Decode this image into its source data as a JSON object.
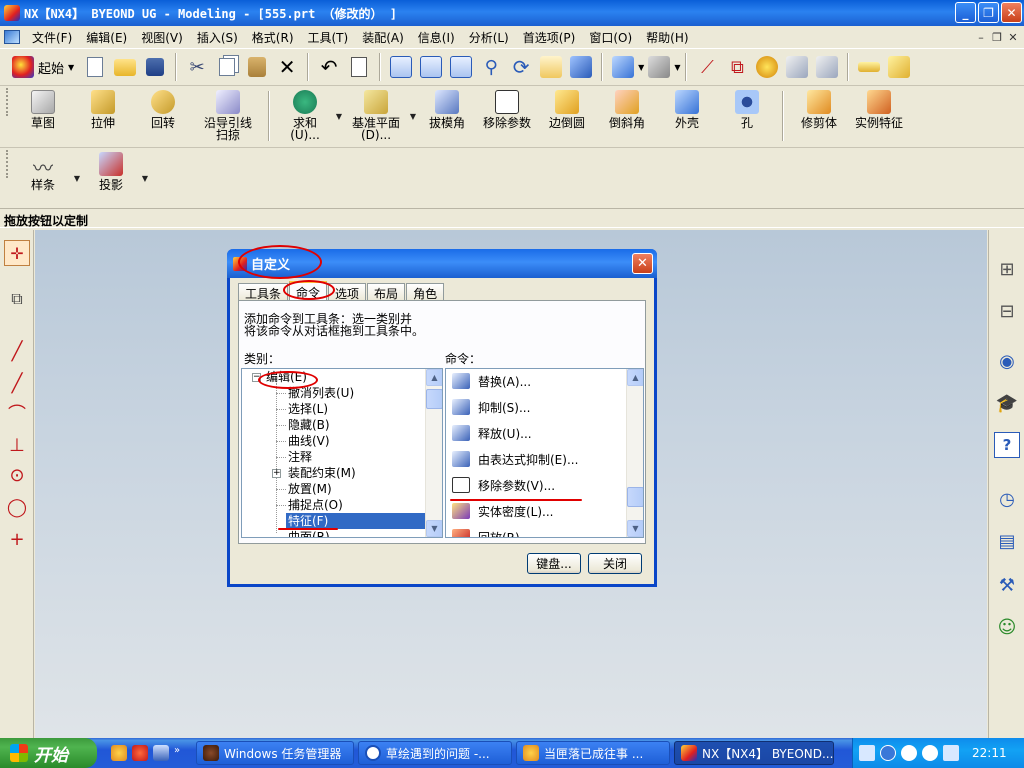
{
  "window": {
    "title": "NX【NX4】 BYEOND UG - Modeling - [555.prt （修改的） ]"
  },
  "menubar": {
    "items": [
      "文件(F)",
      "编辑(E)",
      "视图(V)",
      "插入(S)",
      "格式(R)",
      "工具(T)",
      "装配(A)",
      "信息(I)",
      "分析(L)",
      "首选项(P)",
      "窗口(O)",
      "帮助(H)"
    ]
  },
  "std_toolbar": {
    "start_label": "起始"
  },
  "feature_toolbar": {
    "items": [
      {
        "label": "草图",
        "icon": "sketch-icon"
      },
      {
        "label": "拉伸",
        "icon": "extrude-icon"
      },
      {
        "label": "回转",
        "icon": "revolve-icon"
      },
      {
        "label": "沿导引线\n扫掠",
        "icon": "sweep-icon"
      },
      {
        "label": "求和\n(U)...",
        "icon": "unite-icon"
      },
      {
        "label": "基准平面\n(D)...",
        "icon": "datum-plane-icon"
      },
      {
        "label": "拔模角",
        "icon": "draft-icon"
      },
      {
        "label": "移除参数",
        "icon": "remove-params-icon"
      },
      {
        "label": "边倒圆",
        "icon": "edge-blend-icon"
      },
      {
        "label": "倒斜角",
        "icon": "chamfer-icon"
      },
      {
        "label": "外壳",
        "icon": "shell-icon"
      },
      {
        "label": "孔",
        "icon": "hole-icon"
      },
      {
        "label": "修剪体",
        "icon": "trim-body-icon"
      },
      {
        "label": "实例特征",
        "icon": "instance-feature-icon"
      }
    ]
  },
  "curve_toolbar": {
    "items": [
      {
        "label": "样条",
        "icon": "spline-icon"
      },
      {
        "label": "投影",
        "icon": "project-icon"
      }
    ]
  },
  "status": {
    "text": "拖放按钮以定制"
  },
  "dialog": {
    "title": "自定义",
    "close": "✕",
    "tabs": [
      "工具条",
      "命令",
      "选项",
      "布局",
      "角色"
    ],
    "active_tab": "命令",
    "description_line1": "添加命令到工具条：选一类别并",
    "description_line2": "将该命令从对话框拖到工具条中。",
    "category_label": "类别：",
    "commands_label": "命令：",
    "categories": [
      "编辑(E)",
      "撤消列表(U)",
      "选择(L)",
      "隐藏(B)",
      "曲线(V)",
      "注释",
      "装配约束(M)",
      "放置(M)",
      "捕捉点(O)",
      "特征(F)",
      "曲面(R)"
    ],
    "selected_category": "特征(F)",
    "commands": [
      "替换(A)...",
      "抑制(S)...",
      "释放(U)...",
      "由表达式抑制(E)...",
      "移除参数(V)...",
      "实体密度(L)...",
      "回放(R)..."
    ],
    "keyboard_button": "键盘...",
    "close_button": "关闭"
  },
  "taskbar": {
    "start_label": "开始",
    "tasks": [
      {
        "label": "Windows 任务管理器",
        "active": false
      },
      {
        "label": "草绘遇到的问题 -...",
        "active": false
      },
      {
        "label": "当匣落已成往事 ...",
        "active": false
      },
      {
        "label": "NX【NX4】 BYEOND...",
        "active": true
      }
    ],
    "clock": "22:11"
  },
  "colors": {
    "title_bar": "#0a5fd8",
    "selection": "#316ac5",
    "annotation": "#e00000",
    "canvas": "#c8d4e0",
    "taskbar": "#245dd8",
    "start_button": "#3c9a3c"
  }
}
